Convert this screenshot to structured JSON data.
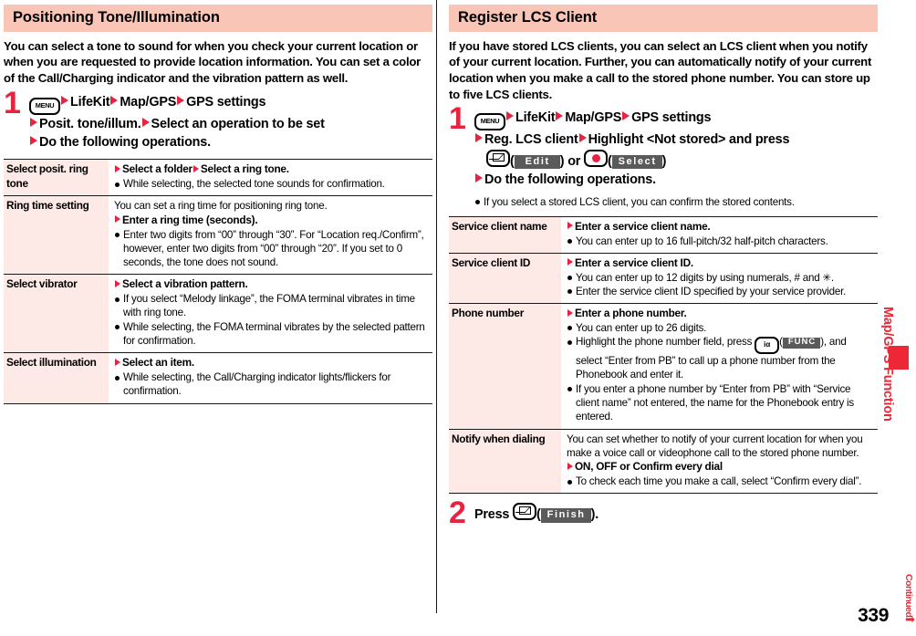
{
  "left": {
    "header": "Positioning Tone/Illumination",
    "intro": "You can select a tone to sound for when you check your current location or when you are requested to provide location information. You can set a color of the Call/Charging indicator and the vibration pattern as well.",
    "step": {
      "number": "1",
      "menu_key_label": "MENU",
      "line1_a": "LifeKit",
      "line1_b": "Map/GPS",
      "line1_c": "GPS settings",
      "line2_a": "Posit. tone/illum.",
      "line2_b": "Select an operation to be set",
      "line3": "Do the following operations."
    },
    "table": [
      {
        "label": "Select posit. ring tone",
        "head_parts": [
          "Select a folder",
          "Select a ring tone."
        ],
        "lead": "",
        "notes": [
          "While selecting, the selected tone sounds for confirmation."
        ],
        "post_notes": []
      },
      {
        "label": "Ring time setting",
        "head_parts": [
          "Enter a ring time (seconds)."
        ],
        "lead": "You can set a ring time for positioning ring tone.",
        "notes": [
          "Enter two digits from “00” through “30”. For “Location req./Confirm”, however, enter two digits from “00” through “20”. If you set to 0 seconds, the tone does not sound."
        ],
        "post_notes": []
      },
      {
        "label": "Select vibrator",
        "head_parts": [
          "Select a vibration pattern."
        ],
        "lead": "",
        "notes": [
          "If you select “Melody linkage”, the FOMA terminal vibrates in time with ring tone.",
          "While selecting, the FOMA terminal vibrates by the selected pattern for confirmation."
        ],
        "post_notes": []
      },
      {
        "label": "Select illumination",
        "head_parts": [
          "Select an item."
        ],
        "lead": "",
        "notes": [
          "While selecting, the Call/Charging indicator lights/flickers for confirmation."
        ],
        "post_notes": []
      }
    ]
  },
  "right": {
    "header": "Register LCS Client",
    "intro": "If you have stored LCS clients, you can select an LCS client when you notify of your current location. Further, you can automatically notify of your current location when you make a call to the stored phone number. You can store up to five LCS clients.",
    "step1": {
      "number": "1",
      "menu_key_label": "MENU",
      "line1_a": "LifeKit",
      "line1_b": "Map/GPS",
      "line1_c": "GPS settings",
      "line2_a": "Reg. LCS client",
      "line2_b": "Highlight <Not stored> and press",
      "line3_edit_chip": "Edit",
      "line3_or": "or",
      "line3_select_chip": "Select",
      "line4": "Do the following operations.",
      "note": "If you select a stored LCS client, you can confirm the stored contents."
    },
    "table": [
      {
        "label": "Service client name",
        "head": "Enter a service client name.",
        "lead": "",
        "notes": [
          "You can enter up to 16 full-pitch/32 half-pitch characters."
        ]
      },
      {
        "label": "Service client ID",
        "head": "Enter a service client ID.",
        "lead": "",
        "notes": [
          "You can enter up to 12 digits by using numerals, # and ✳.",
          "Enter the service client ID specified by your service provider."
        ]
      },
      {
        "label": "Phone number",
        "head": "Enter a phone number.",
        "lead": "",
        "notes": [
          "You can enter up to 26 digits."
        ],
        "func_note_pre": "Highlight the phone number field, press",
        "func_key_chip": "FUNC",
        "func_note_post": ", and select “Enter from PB” to call up a phone number from the Phonebook and enter it.",
        "last_note": "If you enter a phone number by “Enter from PB” with “Service client name” not entered, the name for the Phonebook entry is entered."
      },
      {
        "label": "Notify when dialing",
        "head": "ON, OFF or Confirm every dial",
        "lead": "You can set whether to notify of your current location for when you make a voice call or videophone call to the stored phone number.",
        "notes": [
          "To check each time you make a call, select “Confirm every dial”."
        ]
      }
    ],
    "step2": {
      "number": "2",
      "press_label": "Press",
      "finish_chip": "Finish",
      "trailing": ")."
    }
  },
  "sidebar": {
    "tab_label": "Map/GPS Function",
    "continued": "Continued",
    "continued_arrow": "➡",
    "page_number": "339",
    "accent_color": "#ee2737",
    "header_color": "#f9c5b7",
    "label_cell_color": "#fdeae6"
  }
}
